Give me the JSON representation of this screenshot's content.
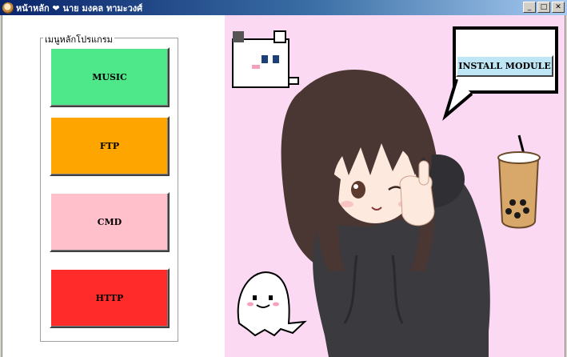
{
  "window": {
    "title": "หน้าหลัก ❤ นาย มงคล ทามะวงศ์",
    "buttons": {
      "minimize": "_",
      "maximize": "□",
      "close": "✕"
    }
  },
  "menu_group": {
    "legend": "เมนูหลักโปรแกรม",
    "buttons": [
      {
        "label": "MUSIC",
        "color": "#4ee88a"
      },
      {
        "label": "FTP",
        "color": "#ffa500"
      },
      {
        "label": "CMD",
        "color": "#ffbfcb"
      },
      {
        "label": "HTTP",
        "color": "#ff2a2a"
      }
    ]
  },
  "install": {
    "label": "INSTALL MODULE",
    "color": "#bfe6f5"
  },
  "colors": {
    "art_background": "#fcd9f2",
    "hoodie": "#3a3a3f",
    "hair": "#4a3733"
  },
  "icons": [
    "app-icon",
    "pixel-cat-icon",
    "ghost-icon",
    "bubble-tea-icon",
    "thumbs-up"
  ]
}
